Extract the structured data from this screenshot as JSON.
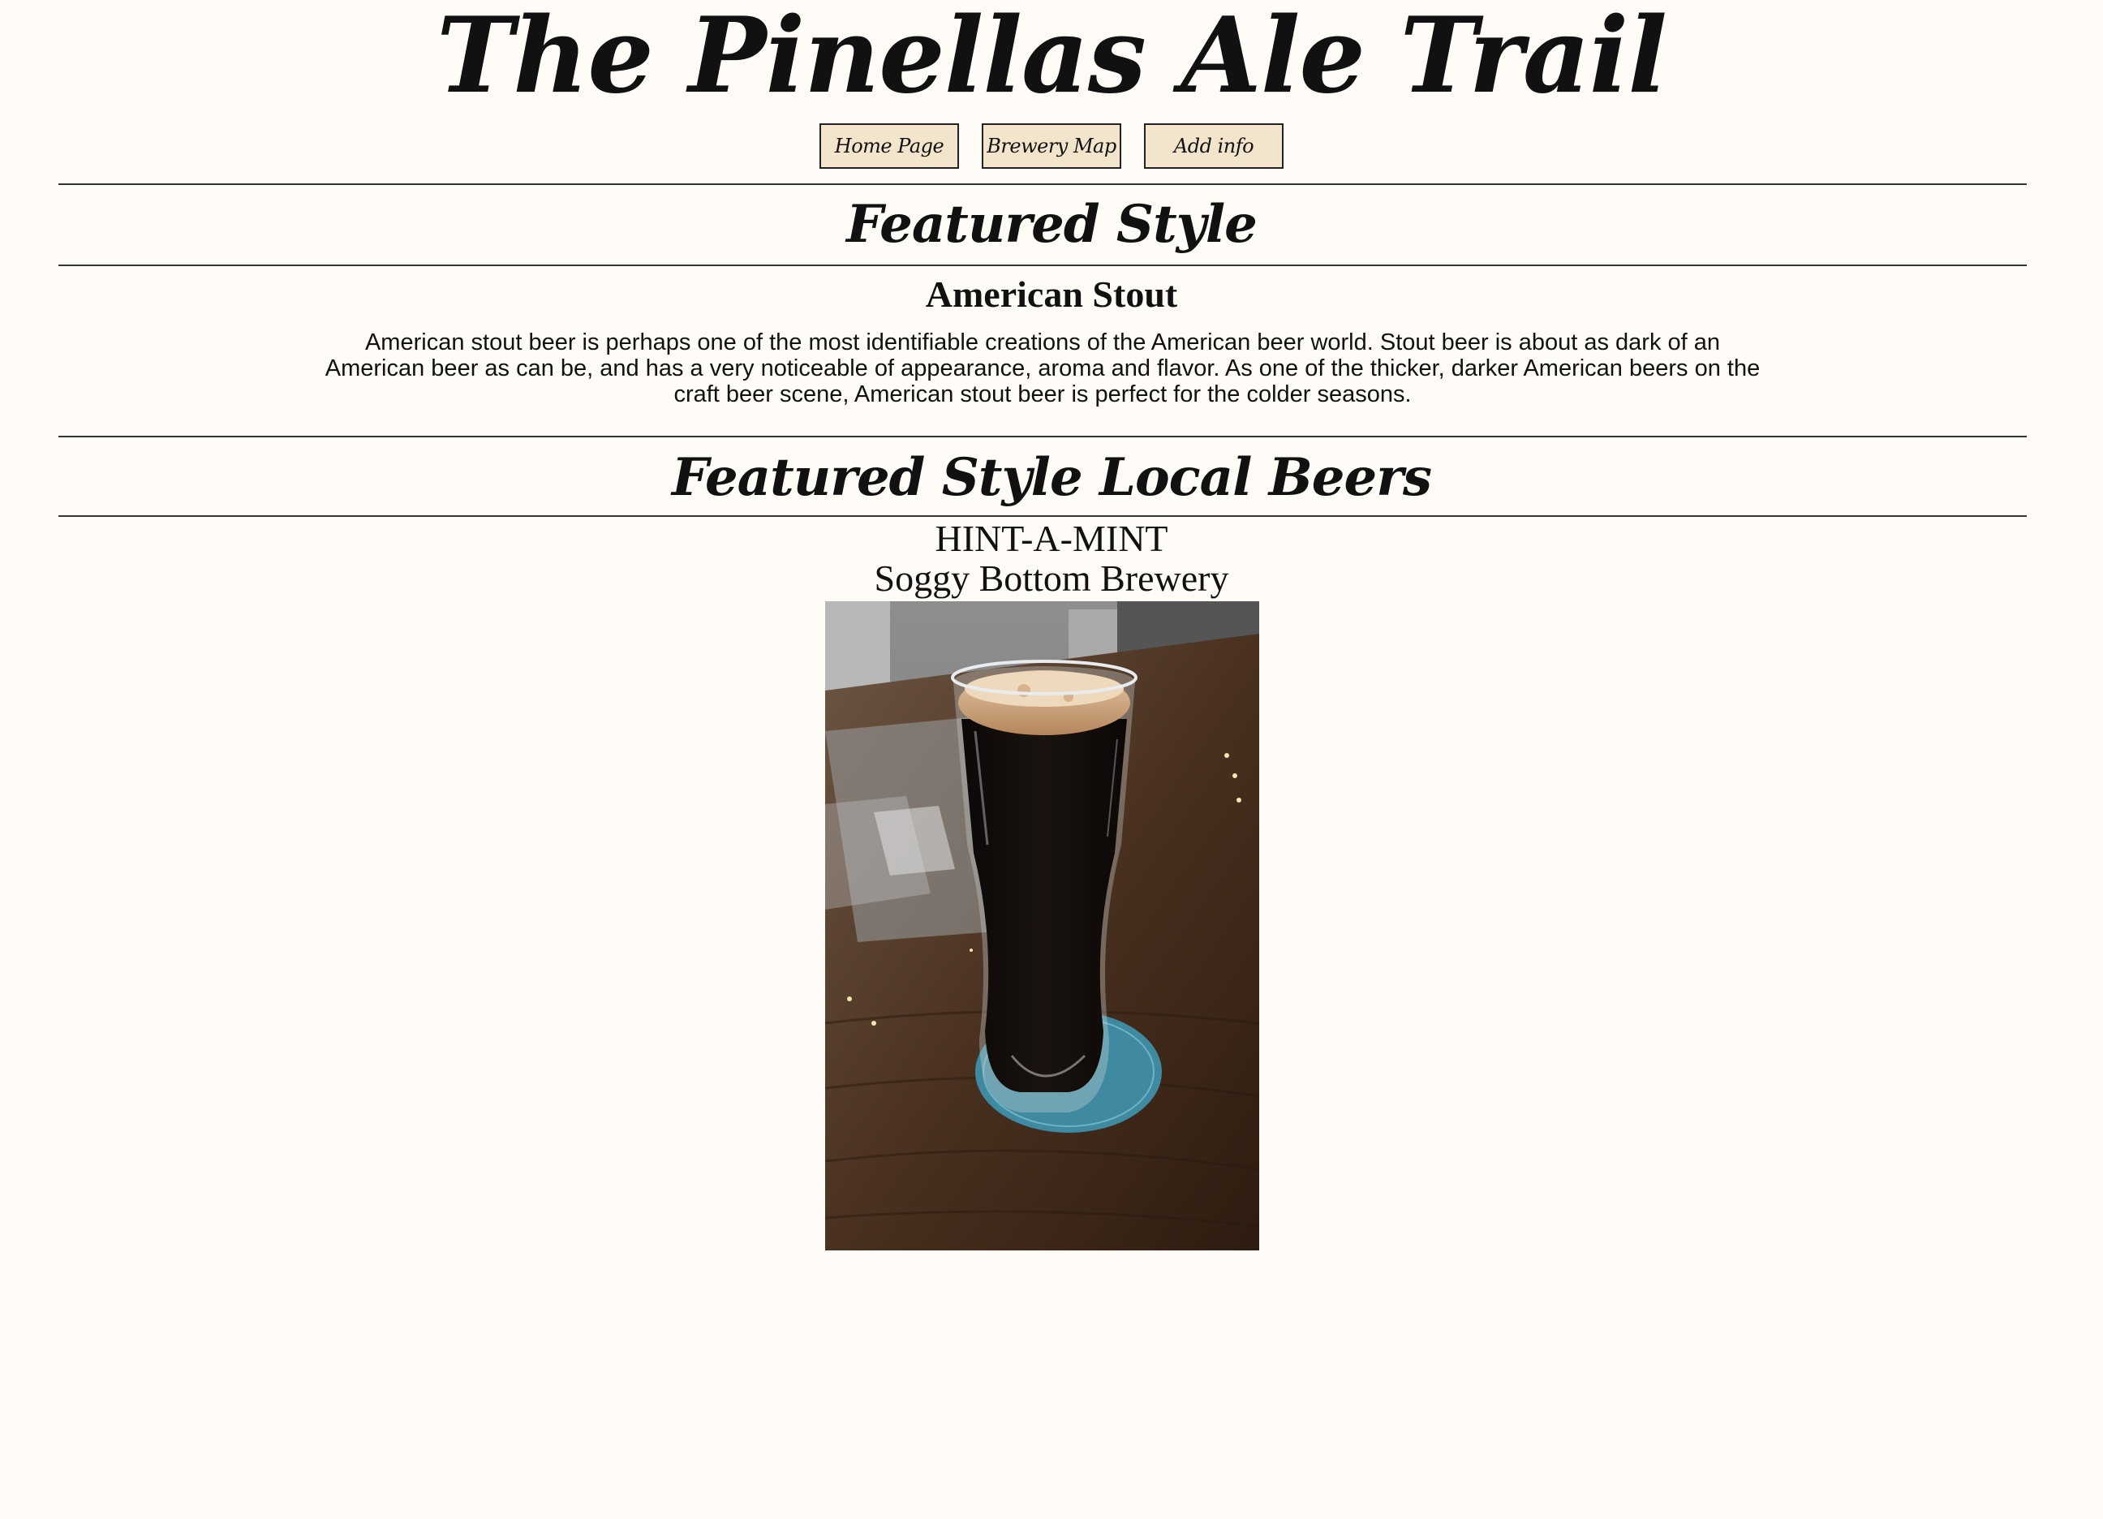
{
  "site": {
    "title": "The Pinellas Ale Trail"
  },
  "nav": {
    "home_label": "Home Page",
    "map_label": "Brewery Map",
    "add_label": "Add info"
  },
  "featured_style": {
    "heading": "Featured Style",
    "name": "American Stout",
    "description": "American stout beer is perhaps one of the most identifiable creations of the American beer world. Stout beer is about as dark of an American beer as can be, and has a very noticeable of appearance, aroma and flavor. As one of the thicker, darker American beers on the craft beer scene, American stout beer is perfect for the colder seasons."
  },
  "local_beers": {
    "heading": "Featured Style Local Beers",
    "beers": [
      {
        "name": "HINT-A-MINT",
        "brewery": "Soggy Bottom Brewery"
      }
    ]
  },
  "colors": {
    "background": "#fffcf8",
    "button_background": "#f3e5cc",
    "text": "#111111"
  }
}
